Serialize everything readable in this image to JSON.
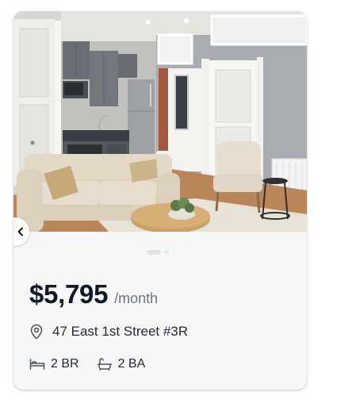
{
  "listing": {
    "price": "$5,795",
    "price_unit": "/month",
    "address": "47 East 1st Street #3R",
    "bedrooms": "2 BR",
    "bathrooms": "2 BA",
    "photo_count": 2,
    "active_photo": 1
  },
  "icons": {
    "prev": "chevron-left-icon",
    "location": "map-pin-icon",
    "bed": "bed-icon",
    "bath": "bathtub-icon"
  },
  "colors": {
    "price_text": "#111827",
    "secondary_text": "#6b7280",
    "card_background": "#f7f7f8"
  }
}
